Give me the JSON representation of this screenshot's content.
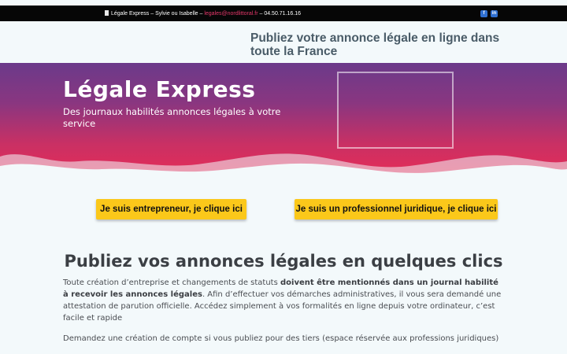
{
  "topbar": {
    "site_name": "Légale Express",
    "sep1": " – ",
    "contacts": " Sylvie ou Isabelle – ",
    "email": "legales@nordlittoral.fr",
    "sep2": " – ",
    "phone": "04.50.71.16.16",
    "icons": [
      "document-icon",
      "facebook-icon",
      "linkedin-icon"
    ],
    "facebook_glyph": "f",
    "linkedin_glyph": "in"
  },
  "tagline": "Publiez votre annonce légale en ligne dans toute la France",
  "hero": {
    "title": "Légale Express",
    "subtitle": "Des journaux habilités annonces légales à votre service",
    "gradient": [
      "#6b3a8a",
      "#e82c56"
    ]
  },
  "cta": {
    "entrepreneur": "Je suis entrepreneur, je clique ici",
    "professional": "Je suis un professionnel juridique, je clique ici",
    "color": "#fbc81a"
  },
  "section": {
    "title": "Publiez vos annonces légales en quelques clics",
    "p1_a": "Toute création d’entreprise et changements de statuts ",
    "p1_b": "doivent être mentionnés dans un journal habilité à recevoir les annonces légales",
    "p1_c": ". Afin d’effectuer vos démarches administratives, il vous sera demandé une attestation de parution officielle. Accédez simplement à vos formalités en ligne depuis votre ordinateur, c’est facile et rapide",
    "p2": "Demandez une création de compte si vous publiez pour des tiers (espace réservée aux professions juridiques)"
  }
}
